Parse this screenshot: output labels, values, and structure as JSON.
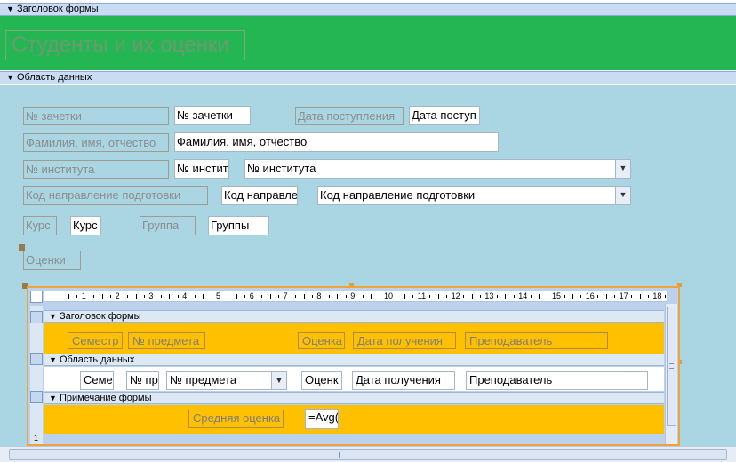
{
  "header_section": {
    "label": "Заголовок формы"
  },
  "form_title": "Студенты и их оценки",
  "detail_section": {
    "label": "Область данных"
  },
  "fields": {
    "zachetka_label": "№ зачетки",
    "zachetka_value": "№ зачетки",
    "data_post_label": "Дата поступления",
    "data_post_value": "Дата поступ",
    "fio_label": "Фамилия, имя, отчество",
    "fio_value": "Фамилия, имя, отчество",
    "institut_label": "№ института",
    "institut_value": "№ инстит",
    "institut_combo": "№ института",
    "napr_label": "Код направление подготовки",
    "napr_value": "Код направле",
    "napr_combo": "Код направление подготовки",
    "kurs_label": "Курс",
    "kurs_value": "Курс",
    "gruppa_label": "Группа",
    "gruppa_value": "Группы",
    "ocenki_label": "Оценки"
  },
  "subform": {
    "ruler_numbers": [
      "1",
      "2",
      "3",
      "4",
      "5",
      "6",
      "7",
      "8",
      "9",
      "10",
      "11",
      "12",
      "13",
      "14",
      "15",
      "16",
      "17",
      "18"
    ],
    "header_label": "Заголовок формы",
    "header_fields": [
      "Семестр",
      "№ предмета",
      "Оценка",
      "Дата получения",
      "Преподаватель"
    ],
    "detail_label": "Область данных",
    "detail_fields": {
      "semestr": "Семе",
      "predmet_num": "№ пр",
      "predmet_combo": "№ предмета",
      "ocenka": "Оценк",
      "data_poluch": "Дата получения",
      "prepod": "Преподаватель"
    },
    "footer_label": "Примечание формы",
    "footer_caption": "Средняя оценка",
    "footer_expr": "=Avg(",
    "left_ruler_digit": "1"
  },
  "colors": {
    "header_band": "#25b654",
    "detail_band": "#a9d6e2",
    "subform_band": "#ffc000",
    "section_bar": "#c9dcf3"
  }
}
